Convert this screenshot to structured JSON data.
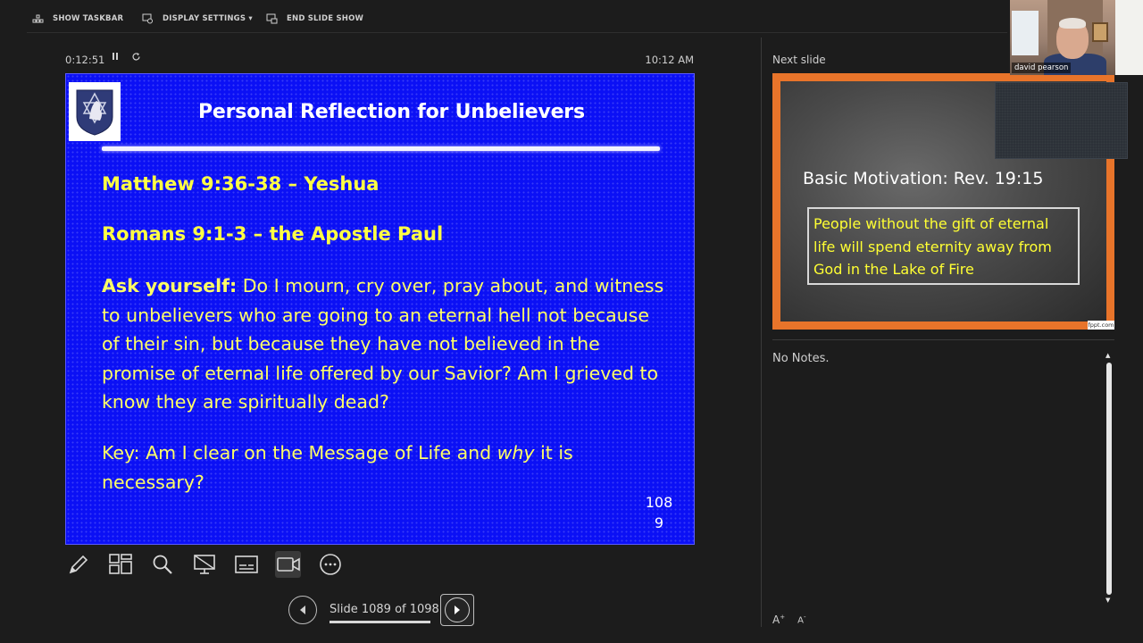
{
  "toolbar": {
    "show_taskbar": "SHOW TASKBAR",
    "display_settings": "DISPLAY SETTINGS ▾",
    "end_slide_show": "END SLIDE SHOW"
  },
  "presenter": {
    "elapsed_time": "0:12:51",
    "clock": "10:12 AM"
  },
  "current_slide": {
    "title": "Personal Reflection for Unbelievers",
    "line1": "Matthew 9:36-38 – Yeshua",
    "line2": "Romans 9:1-3 – the Apostle Paul",
    "ask_label": "Ask yourself:",
    "ask_text": " Do I mourn, cry over, pray about, and witness to unbelievers who are going to an eternal hell not because of their sin, but because they have not believed in the promise of eternal life offered by our Savior? Am I grieved to know they are spiritually dead?",
    "key_prefix": "Key: Am I clear on the Message of Life and ",
    "key_emph": "why",
    "key_suffix": " it is necessary?",
    "page_number_line1": "108",
    "page_number_line2": "9",
    "background_color": "#0b10f5",
    "text_color": "#ffff66"
  },
  "tools": [
    {
      "name": "pen-icon"
    },
    {
      "name": "see-all-slides-icon"
    },
    {
      "name": "zoom-icon"
    },
    {
      "name": "black-screen-icon"
    },
    {
      "name": "subtitles-icon"
    },
    {
      "name": "camera-icon"
    },
    {
      "name": "more-options-icon"
    }
  ],
  "navigation": {
    "counter": "Slide 1089 of 1098"
  },
  "next_slide": {
    "label": "Next slide",
    "title": "Basic Motivation: Rev. 19:15",
    "body": "People without the gift of eternal life will spend eternity away from God in the Lake of Fire",
    "watermark": "fppt.com",
    "frame_color": "#e8742a"
  },
  "notes": {
    "text": "No Notes."
  },
  "webcam": {
    "participant_name": "david pearson"
  }
}
